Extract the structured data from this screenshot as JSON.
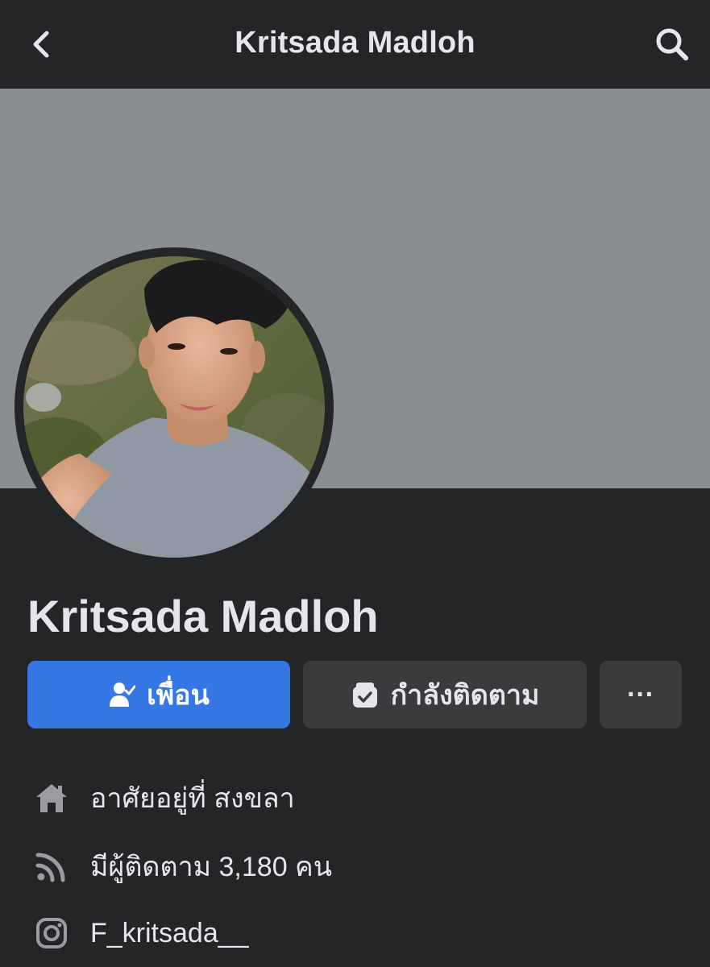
{
  "header": {
    "title": "Kritsada Madloh",
    "back_icon": "chevron-left-icon",
    "search_icon": "search-icon"
  },
  "profile": {
    "name": "Kritsada Madloh"
  },
  "actions": {
    "friend_label": "เพื่อน",
    "following_label": "กำลังติดตาม",
    "more_label": "···"
  },
  "details": [
    {
      "icon": "home-icon",
      "text": "อาศัยอยู่ที่ สงขลา"
    },
    {
      "icon": "rss-icon",
      "text": "มีผู้ติดตาม 3,180 คน"
    },
    {
      "icon": "instagram-icon",
      "text": "F_kritsada__"
    }
  ],
  "colors": {
    "background": "#242526",
    "cover": "#8a8d91",
    "primary_button": "#3578e5",
    "secondary_button": "#3a3b3c",
    "text": "#e4e6eb"
  }
}
